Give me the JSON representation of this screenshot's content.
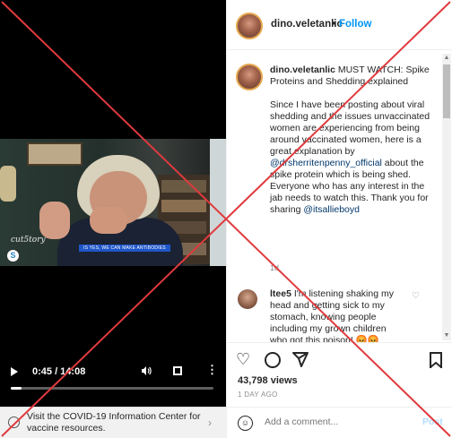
{
  "video": {
    "logo_text": "cut5tory",
    "caption_text": "IS YES, WE CAN MAKE ANTIBODIES",
    "time_display": "0:45 / 14:08",
    "progress": 0.053
  },
  "covid_banner": {
    "text": "Visit the COVID-19 Information Center for vaccine resources."
  },
  "header": {
    "username": "dino.veletanlic",
    "separator": "•",
    "follow_label": "Follow"
  },
  "caption": {
    "username": "dino.veletanlic",
    "title": " MUST WATCH: Spike Proteins and Shedding explained",
    "body_before_mention": "Since I have been posting about viral shedding and the issues unvaccinated women are experiencing from being around vaccinated women, here is a great explanation by ",
    "mention_1": "@drsherritenpenny_official",
    "body_middle": " about the spike protein which is being shed. Everyone who has any interest in the jab needs to watch this. Thank you for sharing ",
    "mention_2": "@itsallieboyd",
    "time": "1d"
  },
  "comment": {
    "username": "ltee5",
    "text": " I'm listening shaking my head and getting sick to my stomach, knowing people including my grown children who got this poison! 😡😡"
  },
  "stats": {
    "views": "43,798 views",
    "time_ago": "1 DAY AGO"
  },
  "add_comment": {
    "placeholder": "Add a comment...",
    "post_label": "Post"
  },
  "colors": {
    "follow_blue": "#0095f6",
    "mention_blue": "#00376b",
    "overlay_red": "#e03a3e"
  }
}
